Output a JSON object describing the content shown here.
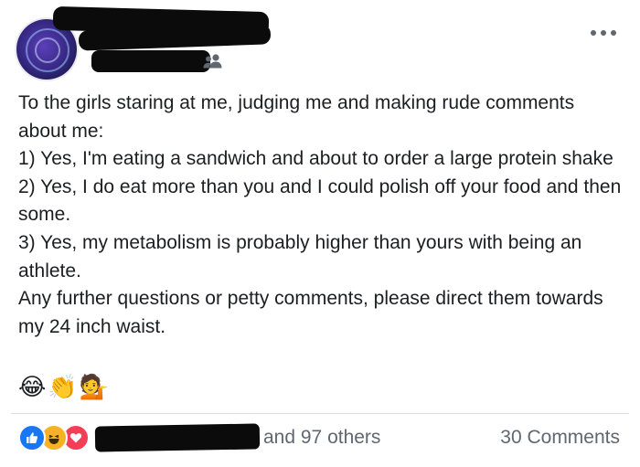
{
  "post": {
    "body_lines": [
      "To the girls staring at me, judging me and making rude comments about me:",
      "1) Yes, I'm eating a sandwich and about to order a large protein shake",
      "2) Yes, I do eat more than you and I could polish off your food and then some.",
      "3) Yes, my metabolism is probably higher than yours with being an athlete.",
      "Any further questions or petty comments, please direct them towards my 24 inch waist."
    ],
    "emojis": [
      "😂",
      "👏",
      "💁"
    ],
    "audience_icon": "friends-icon",
    "more_icon": "more-options-icon"
  },
  "footer": {
    "reaction_icons": [
      "like-icon",
      "haha-icon",
      "love-icon"
    ],
    "reactions_text": "and 97 others",
    "comments_text": "30 Comments"
  },
  "colors": {
    "text": "#1c1e21",
    "secondary_text": "#606770",
    "like": "#1877f2",
    "haha": "#f7b125",
    "love": "#f33e58",
    "redaction": "#0b0b0b"
  }
}
